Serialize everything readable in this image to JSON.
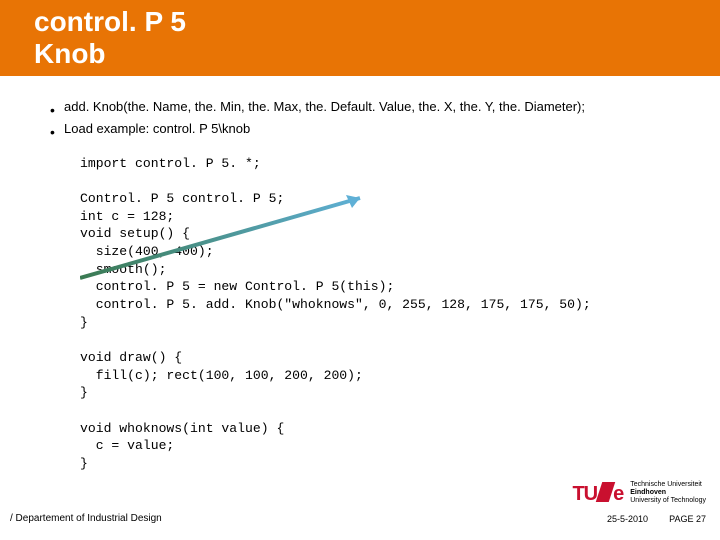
{
  "title": {
    "line1": "control. P 5",
    "line2": "Knob"
  },
  "bullets": {
    "b1": "add. Knob(the. Name, the. Min, the. Max, the. Default. Value, the. X, the. Y, the. Diameter);",
    "b2": " Load example: control. P 5\\knob"
  },
  "code": "import control. P 5. *;\n\nControl. P 5 control. P 5;\nint c = 128;\nvoid setup() {\n  size(400, 400);\n  smooth();\n  control. P 5 = new Control. P 5(this);\n  control. P 5. add. Knob(\"whoknows\", 0, 255, 128, 175, 175, 50);\n}\n\nvoid draw() {\n  fill(c); rect(100, 100, 200, 200);\n}\n\nvoid whoknows(int value) {\n  c = value;\n}",
  "logo": {
    "mark1": "TU",
    "mark2": "e",
    "txt1": "Technische Universiteit",
    "txt2": "Eindhoven",
    "txt3": "University of Technology"
  },
  "footer": {
    "dept": "/ Departement of Industrial Design",
    "date": "25-5-2010",
    "page": "PAGE 27"
  }
}
